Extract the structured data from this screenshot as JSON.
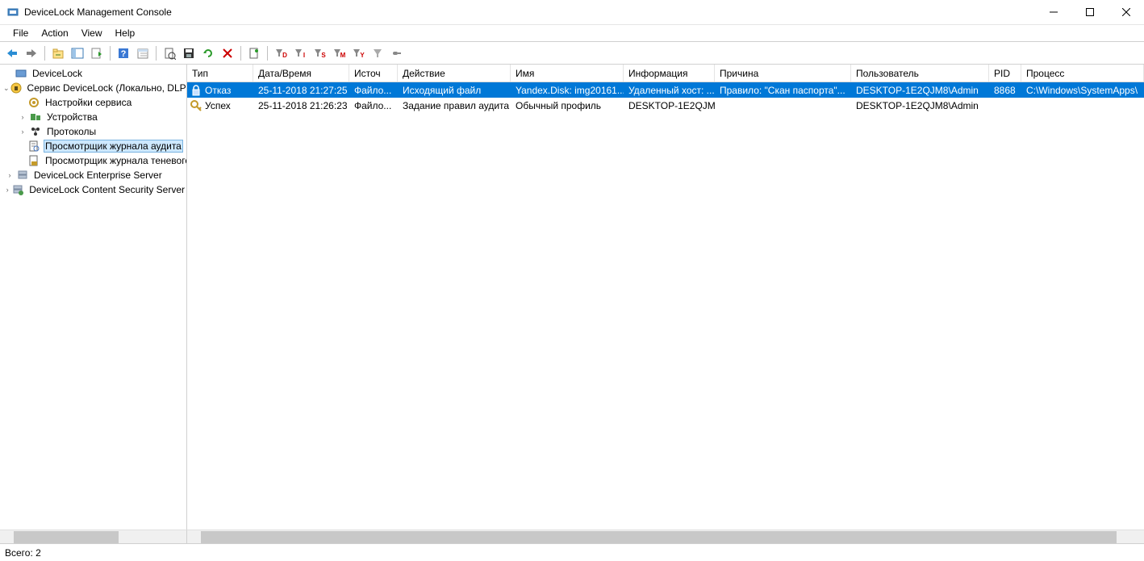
{
  "titlebar": {
    "text": "DeviceLock Management Console"
  },
  "menu": {
    "file": "File",
    "action": "Action",
    "view": "View",
    "help": "Help"
  },
  "tree": {
    "root": "DeviceLock",
    "service": "Сервис DeviceLock (Локально, DLP)",
    "settings": "Настройки сервиса",
    "devices": "Устройства",
    "protocols": "Протоколы",
    "audit_viewer": "Просмотрщик журнала аудита",
    "shadow_viewer": "Просмотрщик журнала теневого",
    "enterprise": "DeviceLock Enterprise Server",
    "content": "DeviceLock Content Security Server"
  },
  "columns": {
    "type": "Тип",
    "datetime": "Дата/Время",
    "source": "Источ",
    "action": "Действие",
    "name": "Имя",
    "info": "Информация",
    "reason": "Причина",
    "user": "Пользователь",
    "pid": "PID",
    "process": "Процесс"
  },
  "rows": [
    {
      "type": "Отказ",
      "datetime": "25-11-2018 21:27:25",
      "source": "Файло...",
      "action": "Исходящий файл",
      "name": "Yandex.Disk: img20161...",
      "info": "Удаленный хост: ...",
      "reason": "Правило: \"Скан паспорта\"...",
      "user": "DESKTOP-1E2QJM8\\Admin",
      "pid": "8868",
      "process": "C:\\Windows\\SystemApps\\",
      "selected": true,
      "icon": "deny"
    },
    {
      "type": "Успех",
      "datetime": "25-11-2018 21:26:23",
      "source": "Файло...",
      "action": "Задание правил аудита",
      "name": "Обычный профиль",
      "info": "DESKTOP-1E2QJM8",
      "reason": "",
      "user": "DESKTOP-1E2QJM8\\Admin",
      "pid": "",
      "process": "",
      "selected": false,
      "icon": "success"
    }
  ],
  "status": {
    "total": "Всего: 2"
  },
  "filters": {
    "yd": "YD",
    "yi": "YI",
    "ys": "YS",
    "ym": "YM",
    "yy": "YY"
  }
}
